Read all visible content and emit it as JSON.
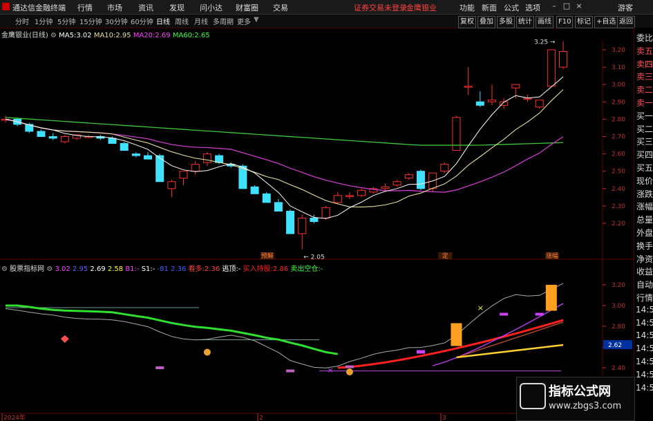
{
  "app": {
    "title": "通达信金融终端",
    "menu": [
      "行情",
      "市场",
      "资讯",
      "发现",
      "问小达",
      "财富圈",
      "交易"
    ],
    "notice": "证券交易未登录",
    "notice2": "金鹰银业",
    "right_menu": [
      "功能",
      "新面",
      "公式",
      "选项"
    ],
    "window_controls": [
      "–",
      "□",
      "×"
    ],
    "extra": "游客"
  },
  "period_tabs": [
    "分时",
    "1分钟",
    "5分钟",
    "15分钟",
    "30分钟",
    "60分钟",
    "日线",
    "周线",
    "月线",
    "多周期",
    "更多"
  ],
  "active_period": "日线",
  "toolbar": [
    "复权",
    "叠加",
    "多股",
    "统计",
    "画线",
    "F10",
    "标记",
    "+自选",
    "返回"
  ],
  "right_panel": [
    "委比",
    "卖五",
    "卖四",
    "卖三",
    "卖二",
    "卖一",
    "买一",
    "买二",
    "买三",
    "买四",
    "买五",
    "现价",
    "涨跌",
    "涨幅",
    "总量",
    "外盘",
    "换手",
    "净资",
    "收益",
    "自动",
    "行情",
    "14:50",
    "14:50",
    "14:50",
    "14:50",
    "14:50",
    "14:50",
    "14:50"
  ],
  "main_chart": {
    "stock_name": "金鹰银业(日线)",
    "ma_legend": [
      {
        "label": "MA5:",
        "value": "3.02",
        "color": "#ffffff"
      },
      {
        "label": "MA10:",
        "value": "2.95",
        "color": "#e8e0a0"
      },
      {
        "label": "MA20:",
        "value": "2.69",
        "color": "#ff40ff"
      },
      {
        "label": "MA60:",
        "value": "2.65",
        "color": "#40ff40"
      }
    ],
    "price_axis": [
      "3.20",
      "3.10",
      "3.00",
      "2.90",
      "2.80",
      "2.70",
      "2.60",
      "2.50",
      "2.40",
      "2.30",
      "2.20"
    ],
    "high_mark": "3.25",
    "low_mark": "2.05",
    "event_labels": [
      "预解",
      "定",
      "涨幅"
    ]
  },
  "sub_chart": {
    "name": "股票指标网",
    "legend": [
      {
        "label": "",
        "value": "3.02",
        "color": "#ff40ff"
      },
      {
        "label": "",
        "value": "2.95",
        "color": "#6060ff"
      },
      {
        "label": "",
        "value": "2.69",
        "color": "#ffffff"
      },
      {
        "label": "",
        "value": "2.58",
        "color": "#ffff40"
      },
      {
        "label": "B1:",
        "value": "-",
        "color": "#ff40ff"
      },
      {
        "label": "S1:",
        "value": "-",
        "color": "#ffffff"
      },
      {
        "label": "",
        "value": "-81",
        "color": "#4060ff"
      },
      {
        "label": "",
        "value": "2.36",
        "color": "#4060ff"
      },
      {
        "label": "看多:",
        "value": "2.36",
        "color": "#ff4040"
      },
      {
        "label": "逃顶:",
        "value": "-",
        "color": "#ffffff"
      },
      {
        "label": "买入持股:",
        "value": "2.86",
        "color": "#ff2020"
      },
      {
        "label": "卖出空仓:",
        "value": "-",
        "color": "#40ff40"
      }
    ],
    "price_axis": [
      "3.20",
      "3.00",
      "2.80",
      "2.62",
      "2.60",
      "2.40"
    ],
    "current_value": "2.62"
  },
  "time_axis": [
    "2024年",
    "2",
    "3"
  ],
  "watermark": {
    "line1": "指标公式网",
    "line2": "www.zbgs3.com"
  },
  "colors": {
    "up": "#ff3030",
    "down": "#40e0ff",
    "axis": "#c03030",
    "ma60": "#3cc83c",
    "ma20": "#c83cc8",
    "ma10": "#e8e0a0"
  },
  "candles": [
    [
      2.8,
      2.82,
      2.78,
      2.8
    ],
    [
      2.8,
      2.81,
      2.76,
      2.77
    ],
    [
      2.77,
      2.78,
      2.72,
      2.73
    ],
    [
      2.73,
      2.74,
      2.7,
      2.7
    ],
    [
      2.7,
      2.72,
      2.68,
      2.69
    ],
    [
      2.67,
      2.71,
      2.66,
      2.7
    ],
    [
      2.69,
      2.71,
      2.68,
      2.71
    ],
    [
      2.7,
      2.71,
      2.69,
      2.7
    ],
    [
      2.7,
      2.71,
      2.68,
      2.69
    ],
    [
      2.69,
      2.7,
      2.66,
      2.66
    ],
    [
      2.66,
      2.67,
      2.62,
      2.62
    ],
    [
      2.6,
      2.61,
      2.58,
      2.59
    ],
    [
      2.59,
      2.61,
      2.57,
      2.57
    ],
    [
      2.59,
      2.6,
      2.44,
      2.44
    ],
    [
      2.4,
      2.45,
      2.35,
      2.44
    ],
    [
      2.46,
      2.5,
      2.42,
      2.5
    ],
    [
      2.5,
      2.56,
      2.48,
      2.54
    ],
    [
      2.55,
      2.61,
      2.53,
      2.6
    ],
    [
      2.59,
      2.6,
      2.54,
      2.55
    ],
    [
      2.54,
      2.55,
      2.52,
      2.53
    ],
    [
      2.53,
      2.54,
      2.4,
      2.4
    ],
    [
      2.41,
      2.42,
      2.37,
      2.37
    ],
    [
      2.37,
      2.38,
      2.32,
      2.32
    ],
    [
      2.32,
      2.34,
      2.27,
      2.27
    ],
    [
      2.27,
      2.28,
      2.14,
      2.14
    ],
    [
      2.14,
      2.25,
      2.05,
      2.23
    ],
    [
      2.23,
      2.25,
      2.2,
      2.21
    ],
    [
      2.23,
      2.3,
      2.22,
      2.29
    ],
    [
      2.32,
      2.38,
      2.31,
      2.36
    ],
    [
      2.36,
      2.38,
      2.34,
      2.36
    ],
    [
      2.36,
      2.4,
      2.35,
      2.39
    ],
    [
      2.38,
      2.41,
      2.37,
      2.4
    ],
    [
      2.4,
      2.43,
      2.39,
      2.41
    ],
    [
      2.42,
      2.45,
      2.41,
      2.44
    ],
    [
      2.46,
      2.49,
      2.45,
      2.48
    ],
    [
      2.5,
      2.51,
      2.39,
      2.4
    ],
    [
      2.4,
      2.49,
      2.38,
      2.49
    ],
    [
      2.5,
      2.55,
      2.49,
      2.54
    ],
    [
      2.62,
      2.82,
      2.62,
      2.81
    ],
    [
      2.99,
      3.1,
      2.94,
      2.99
    ],
    [
      2.9,
      2.96,
      2.87,
      2.88
    ],
    [
      2.9,
      3.0,
      2.88,
      2.91
    ],
    [
      2.88,
      2.92,
      2.86,
      2.9
    ],
    [
      2.98,
      3.0,
      2.92,
      3.0
    ],
    [
      2.92,
      2.94,
      2.9,
      2.92
    ],
    [
      2.87,
      2.91,
      2.86,
      2.91
    ],
    [
      2.99,
      3.2,
      2.99,
      3.2
    ],
    [
      3.1,
      3.25,
      3.09,
      3.19
    ]
  ]
}
